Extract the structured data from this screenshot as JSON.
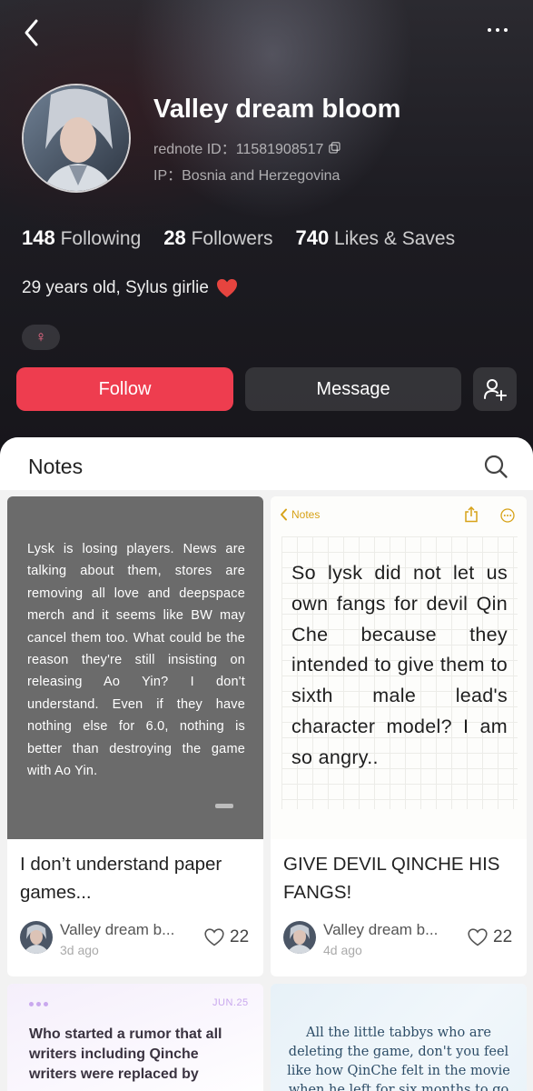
{
  "profile": {
    "name": "Valley dream bloom",
    "rednote_id": "rednote ID：11581908517",
    "ip": "IP：Bosnia and Herzegovina",
    "bio": "29 years old, Sylus girlie",
    "bio_emoji": "heart-icon",
    "gender_symbol": "♀",
    "stats": {
      "following_count": "148",
      "following_label": "Following",
      "followers_count": "28",
      "followers_label": "Followers",
      "likes_count": "740",
      "likes_label": "Likes & Saves"
    }
  },
  "actions": {
    "follow_label": "Follow",
    "message_label": "Message"
  },
  "notes_section": {
    "title": "Notes"
  },
  "cards": [
    {
      "cover_text": "Lysk is losing players. News are talking about them, stores are removing all love and deepspace merch and it seems like BW may cancel them too. What could be the reason they're still insisting on releasing Ao Yin? I don't understand. Even if they have nothing else for 6.0, nothing is better than destroying the game with Ao Yin.",
      "title": "I don’t understand paper games...",
      "author": "Valley dream b...",
      "time": "3d ago",
      "likes": "22"
    },
    {
      "cover_header": "Notes",
      "cover_text": "So lysk did not let us own fangs for devil Qin Che because they intended to give them to sixth male lead's character model? I am so angry..",
      "title": "GIVE DEVIL QINCHE HIS FANGS!",
      "author": "Valley dream b...",
      "time": "4d ago",
      "likes": "22"
    },
    {
      "cover_date": "JUN.25",
      "cover_text": "Who started a rumor that all writers including Qinche writers were replaced by"
    },
    {
      "cover_text": "All the little tabbys who are deleting the game, don't you feel like how QinChe felt in the movie when he left for six months to go"
    }
  ],
  "colors": {
    "follow_button": "#ee3d4f",
    "header_bg": "#1d1c22",
    "notes_accent": "#d7a217"
  }
}
